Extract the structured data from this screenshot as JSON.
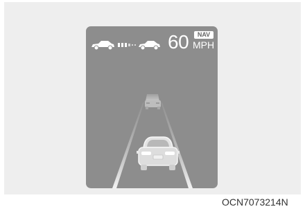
{
  "display": {
    "set_speed": "60",
    "speed_unit": "MPH",
    "nav_badge": "NAV"
  },
  "icons": {
    "ego_vehicle": "car-side-icon",
    "distance_bars": "following-distance-icon",
    "lead_vehicle": "car-side-icon",
    "lead_car_ahead": "car-rear-icon",
    "own_car": "car-rear-icon"
  },
  "colors": {
    "screen": "#8d8d8d",
    "text": "#ffffff",
    "frame": "#eeeeee"
  },
  "figure_code": "OCN7073214N"
}
